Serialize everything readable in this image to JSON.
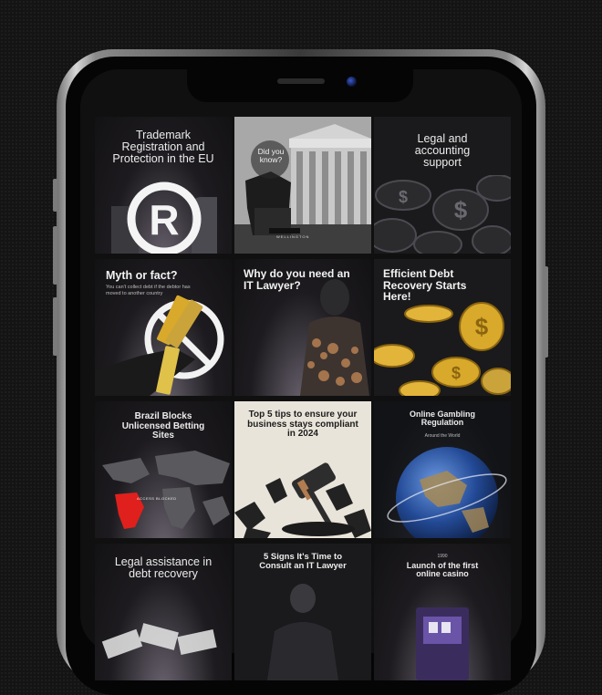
{
  "tiles": [
    {
      "title": "Trademark Registration and Protection in the EU",
      "icon": "registered-icon"
    },
    {
      "title": "Did you know?",
      "caption": "WELLINGTON"
    },
    {
      "title": "Legal and accounting support",
      "icon": "dollar-coin-icon"
    },
    {
      "title": "Myth or fact?",
      "subtitle": "You can't collect debt if the debtor has moved to another country"
    },
    {
      "title": "Why do you need an IT Lawyer?"
    },
    {
      "title": "Efficient Debt Recovery Starts Here!",
      "icon": "dollar-coin-icon"
    },
    {
      "title": "Brazil Blocks Unlicensed Betting Sites",
      "badge": "ACCESS BLOCKED"
    },
    {
      "title": "Top 5 tips to ensure your business stays compliant in 2024",
      "icon": "gavel-icon"
    },
    {
      "title": "Online Gambling Regulation",
      "subtitle": "Around the World"
    },
    {
      "title": "Legal assistance in debt recovery"
    },
    {
      "title": "5 Signs It's Time to Consult an IT Lawyer"
    },
    {
      "title": "Launch of the first online casino",
      "kicker": "1990"
    }
  ],
  "colors": {
    "accent_gold": "#d8a92a",
    "accent_red": "#e0201c",
    "paper": "#e9e4da"
  }
}
